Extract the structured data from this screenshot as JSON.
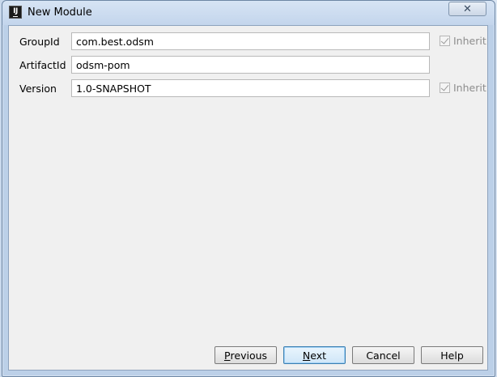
{
  "window": {
    "title": "New Module",
    "close_symbol": "✕"
  },
  "form": {
    "group_id": {
      "label": "GroupId",
      "value": "com.best.odsm",
      "inherit_label": "Inherit",
      "inherit_checked": true
    },
    "artifact_id": {
      "label": "ArtifactId",
      "value": "odsm-pom"
    },
    "version": {
      "label": "Version",
      "value": "1.0-SNAPSHOT",
      "inherit_label": "Inherit",
      "inherit_checked": true
    }
  },
  "buttons": {
    "previous": {
      "mnemonic": "P",
      "rest": "revious"
    },
    "next": {
      "mnemonic": "N",
      "rest": "ext"
    },
    "cancel": "Cancel",
    "help": "Help"
  },
  "colors": {
    "dialog_background": "#f0f0f0",
    "title_bar": "#c3d5ec",
    "default_button_border": "#3c7fb1"
  }
}
